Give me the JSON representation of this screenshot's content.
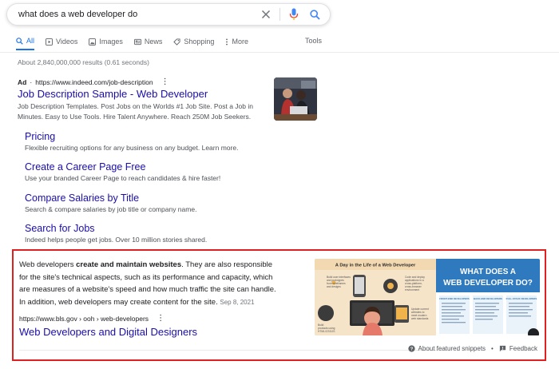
{
  "search": {
    "query": "what does a web developer do"
  },
  "tabs": [
    {
      "label": "All",
      "icon": "search-icon"
    },
    {
      "label": "Videos",
      "icon": "video-icon"
    },
    {
      "label": "Images",
      "icon": "image-icon"
    },
    {
      "label": "News",
      "icon": "news-icon"
    },
    {
      "label": "Shopping",
      "icon": "tag-icon"
    },
    {
      "label": "More",
      "icon": "more-vertical-icon"
    }
  ],
  "tools_label": "Tools",
  "result_stats": "About 2,840,000,000 results (0.61 seconds)",
  "ad": {
    "badge": "Ad",
    "url": "https://www.indeed.com/job-description",
    "title": "Job Description Sample - Web Developer",
    "description": "Job Description Templates. Post Jobs on the Worlds #1 Job Site. Post a Job in Minutes. Easy to Use Tools. Hire Talent Anywhere. Reach 250M Job Seekers.",
    "sitelinks": [
      {
        "title": "Pricing",
        "desc": "Flexible recruiting options for any business on any budget. Learn more."
      },
      {
        "title": "Create a Career Page Free",
        "desc": "Use your branded Career Page to reach candidates & hire faster!"
      },
      {
        "title": "Compare Salaries by Title",
        "desc": "Search & compare salaries by job title or company name."
      },
      {
        "title": "Search for Jobs",
        "desc": "Indeed helps people get jobs. Over 10 million stories shared."
      }
    ]
  },
  "snippet": {
    "text_before": "Web developers ",
    "text_bold": "create and maintain websites",
    "text_after": ". They are also responsible for the site's technical aspects, such as its performance and capacity, which are measures of a website's speed and how much traffic the site can handle. In addition, web developers may create content for the site.",
    "date": "Sep 8, 2021",
    "url": "https://www.bls.gov › ooh › web-developers",
    "title": "Web Developers and Digital Designers",
    "image": {
      "left_title": "A Day in the Life of a Web Developer",
      "right_title": "WHAT DOES A WEB DEVELOPER DO?",
      "captions": [
        "Build user interfaces and prototypes from wireframes and designs",
        "Code and deploy applications in a cross-platform, cross-browser environment",
        "Build products using HTML/CSS/JS",
        "Update current websites to meet modern web standards"
      ],
      "columns": [
        "FRONT-END DEVELOPERS",
        "BACK-END DEVELOPERS",
        "FULL-STACK DEVELOPERS"
      ]
    },
    "about_label": "About featured snippets",
    "feedback_label": "Feedback"
  },
  "colors": {
    "link": "#1a0dab",
    "accent": "#1a73e8",
    "highlight_border": "#e02020"
  }
}
